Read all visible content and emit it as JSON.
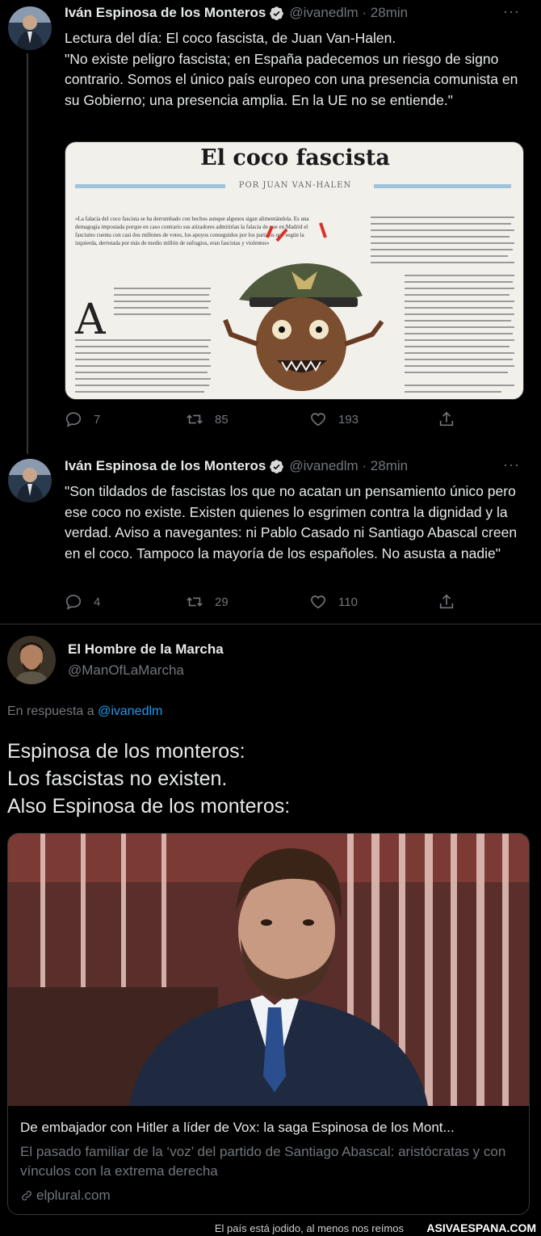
{
  "tweet1": {
    "author_name": "Iván Espinosa de los Monteros",
    "handle_time": "@ivanedlm · 28min",
    "more": "···",
    "text": "Lectura del día: El coco fascista, de Juan Van-Halen.\n\"No existe peligro fascista; en España padecemos un riesgo de signo contrario. Somos el único país europeo con una presencia comunista en su Gobierno; una presencia amplia. En la UE no se entiende.\"",
    "article": {
      "headline": "El coco fascista",
      "byline": "POR JUAN VAN-HALEN",
      "pullquote": "«La falacia del coco fascista se ha derrumbado con hechos aunque algunos sigan alimentándola. Es una demagogia impostada porque en caso contrario sus atizadores admitirían la falacia de que en Madrid el fascismo cuenta con casi dos millones de votos, los apoyos conseguidos por los partidos que según la izquierda, derrotada por más de medio millón de sufragios, eran fascistas y violentos»",
      "dropcap": "A"
    },
    "replies": "7",
    "retweets": "85",
    "likes": "193"
  },
  "tweet2": {
    "author_name": "Iván Espinosa de los Monteros",
    "handle_time": "@ivanedlm · 28min",
    "more": "···",
    "text": "\"Son tildados de fascistas los que no acatan un pensamiento único pero ese coco no existe. Existen quienes lo esgrimen contra la dignidad y la verdad. Aviso a navegantes: ni Pablo Casado ni Santiago Abascal creen en el coco. Tampoco la mayoría de los españoles. No asusta a nadie\"",
    "replies": "4",
    "retweets": "29",
    "likes": "110"
  },
  "reply": {
    "author_name": "El Hombre de la Marcha",
    "handle": "@ManOfLaMarcha",
    "in_reply_prefix": "En respuesta a",
    "in_reply_handle": "@ivanedlm",
    "text": "Espinosa de los monteros:\nLos fascistas no existen.\nAlso Espinosa de los monteros:",
    "card": {
      "title": "De embajador con Hitler a líder de Vox: la saga Espinosa de los Mont...",
      "description": "El pasado familiar de la ‘voz’ del partido de Santiago Abascal: aristócratas y con vínculos con la extrema derecha",
      "domain": "elplural.com"
    }
  },
  "footer": {
    "tagline": "El país está jodido, al menos nos reímos",
    "site": "ASIVAESPANA.COM"
  },
  "colors": {
    "background": "#000000",
    "text": "#e7e9ea",
    "muted": "#71767b",
    "link": "#1d9bf0",
    "verified": "#d9d9d9"
  }
}
